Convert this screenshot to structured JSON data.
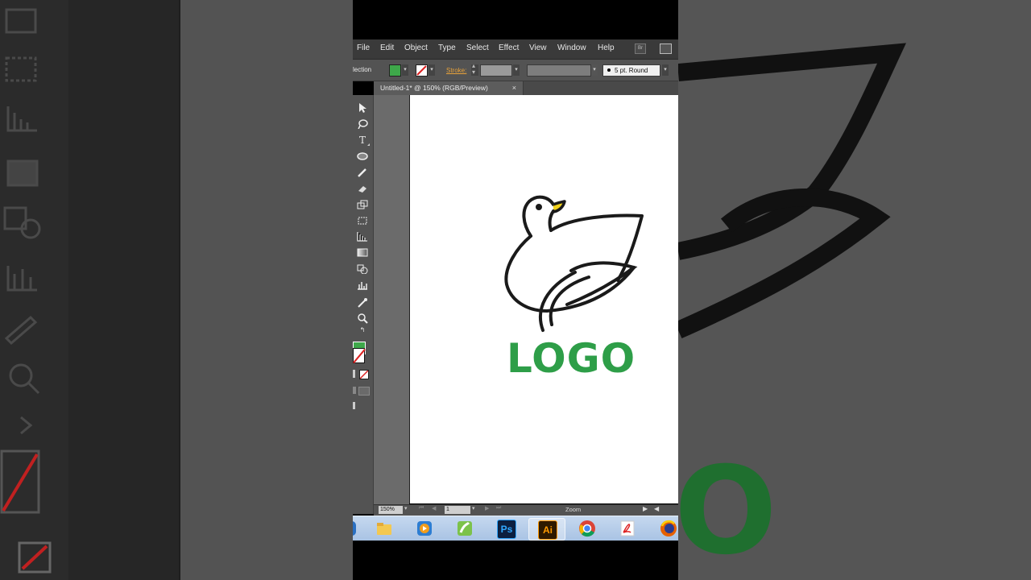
{
  "menu": [
    "File",
    "Edit",
    "Object",
    "Type",
    "Select",
    "Effect",
    "View",
    "Window",
    "Help"
  ],
  "menu_bridge": "Br",
  "control": {
    "selection_label": "lection",
    "stroke_label": "Stroke:",
    "brush_label": "5 pt. Round",
    "fill_color": "#3ea84a"
  },
  "document_tab": {
    "title": "Untitled-1* @ 150% (RGB/Preview)",
    "close": "×"
  },
  "artwork": {
    "logo_text": "LOGO",
    "logo_color": "#2e9e48",
    "beak_color": "#f2d21b",
    "line_color": "#1a1a1a"
  },
  "status": {
    "zoom": "150%",
    "page": "1",
    "tool_name": "Zoom"
  },
  "taskbar_apps": [
    {
      "name": "file-explorer",
      "label": ""
    },
    {
      "name": "media-player",
      "label": ""
    },
    {
      "name": "app-green",
      "label": ""
    },
    {
      "name": "photoshop",
      "label": "Ps"
    },
    {
      "name": "illustrator",
      "label": "Ai"
    },
    {
      "name": "chrome",
      "label": ""
    },
    {
      "name": "acrobat",
      "label": ""
    },
    {
      "name": "firefox",
      "label": ""
    }
  ],
  "background": {
    "big_logo_fragment": "GO"
  }
}
